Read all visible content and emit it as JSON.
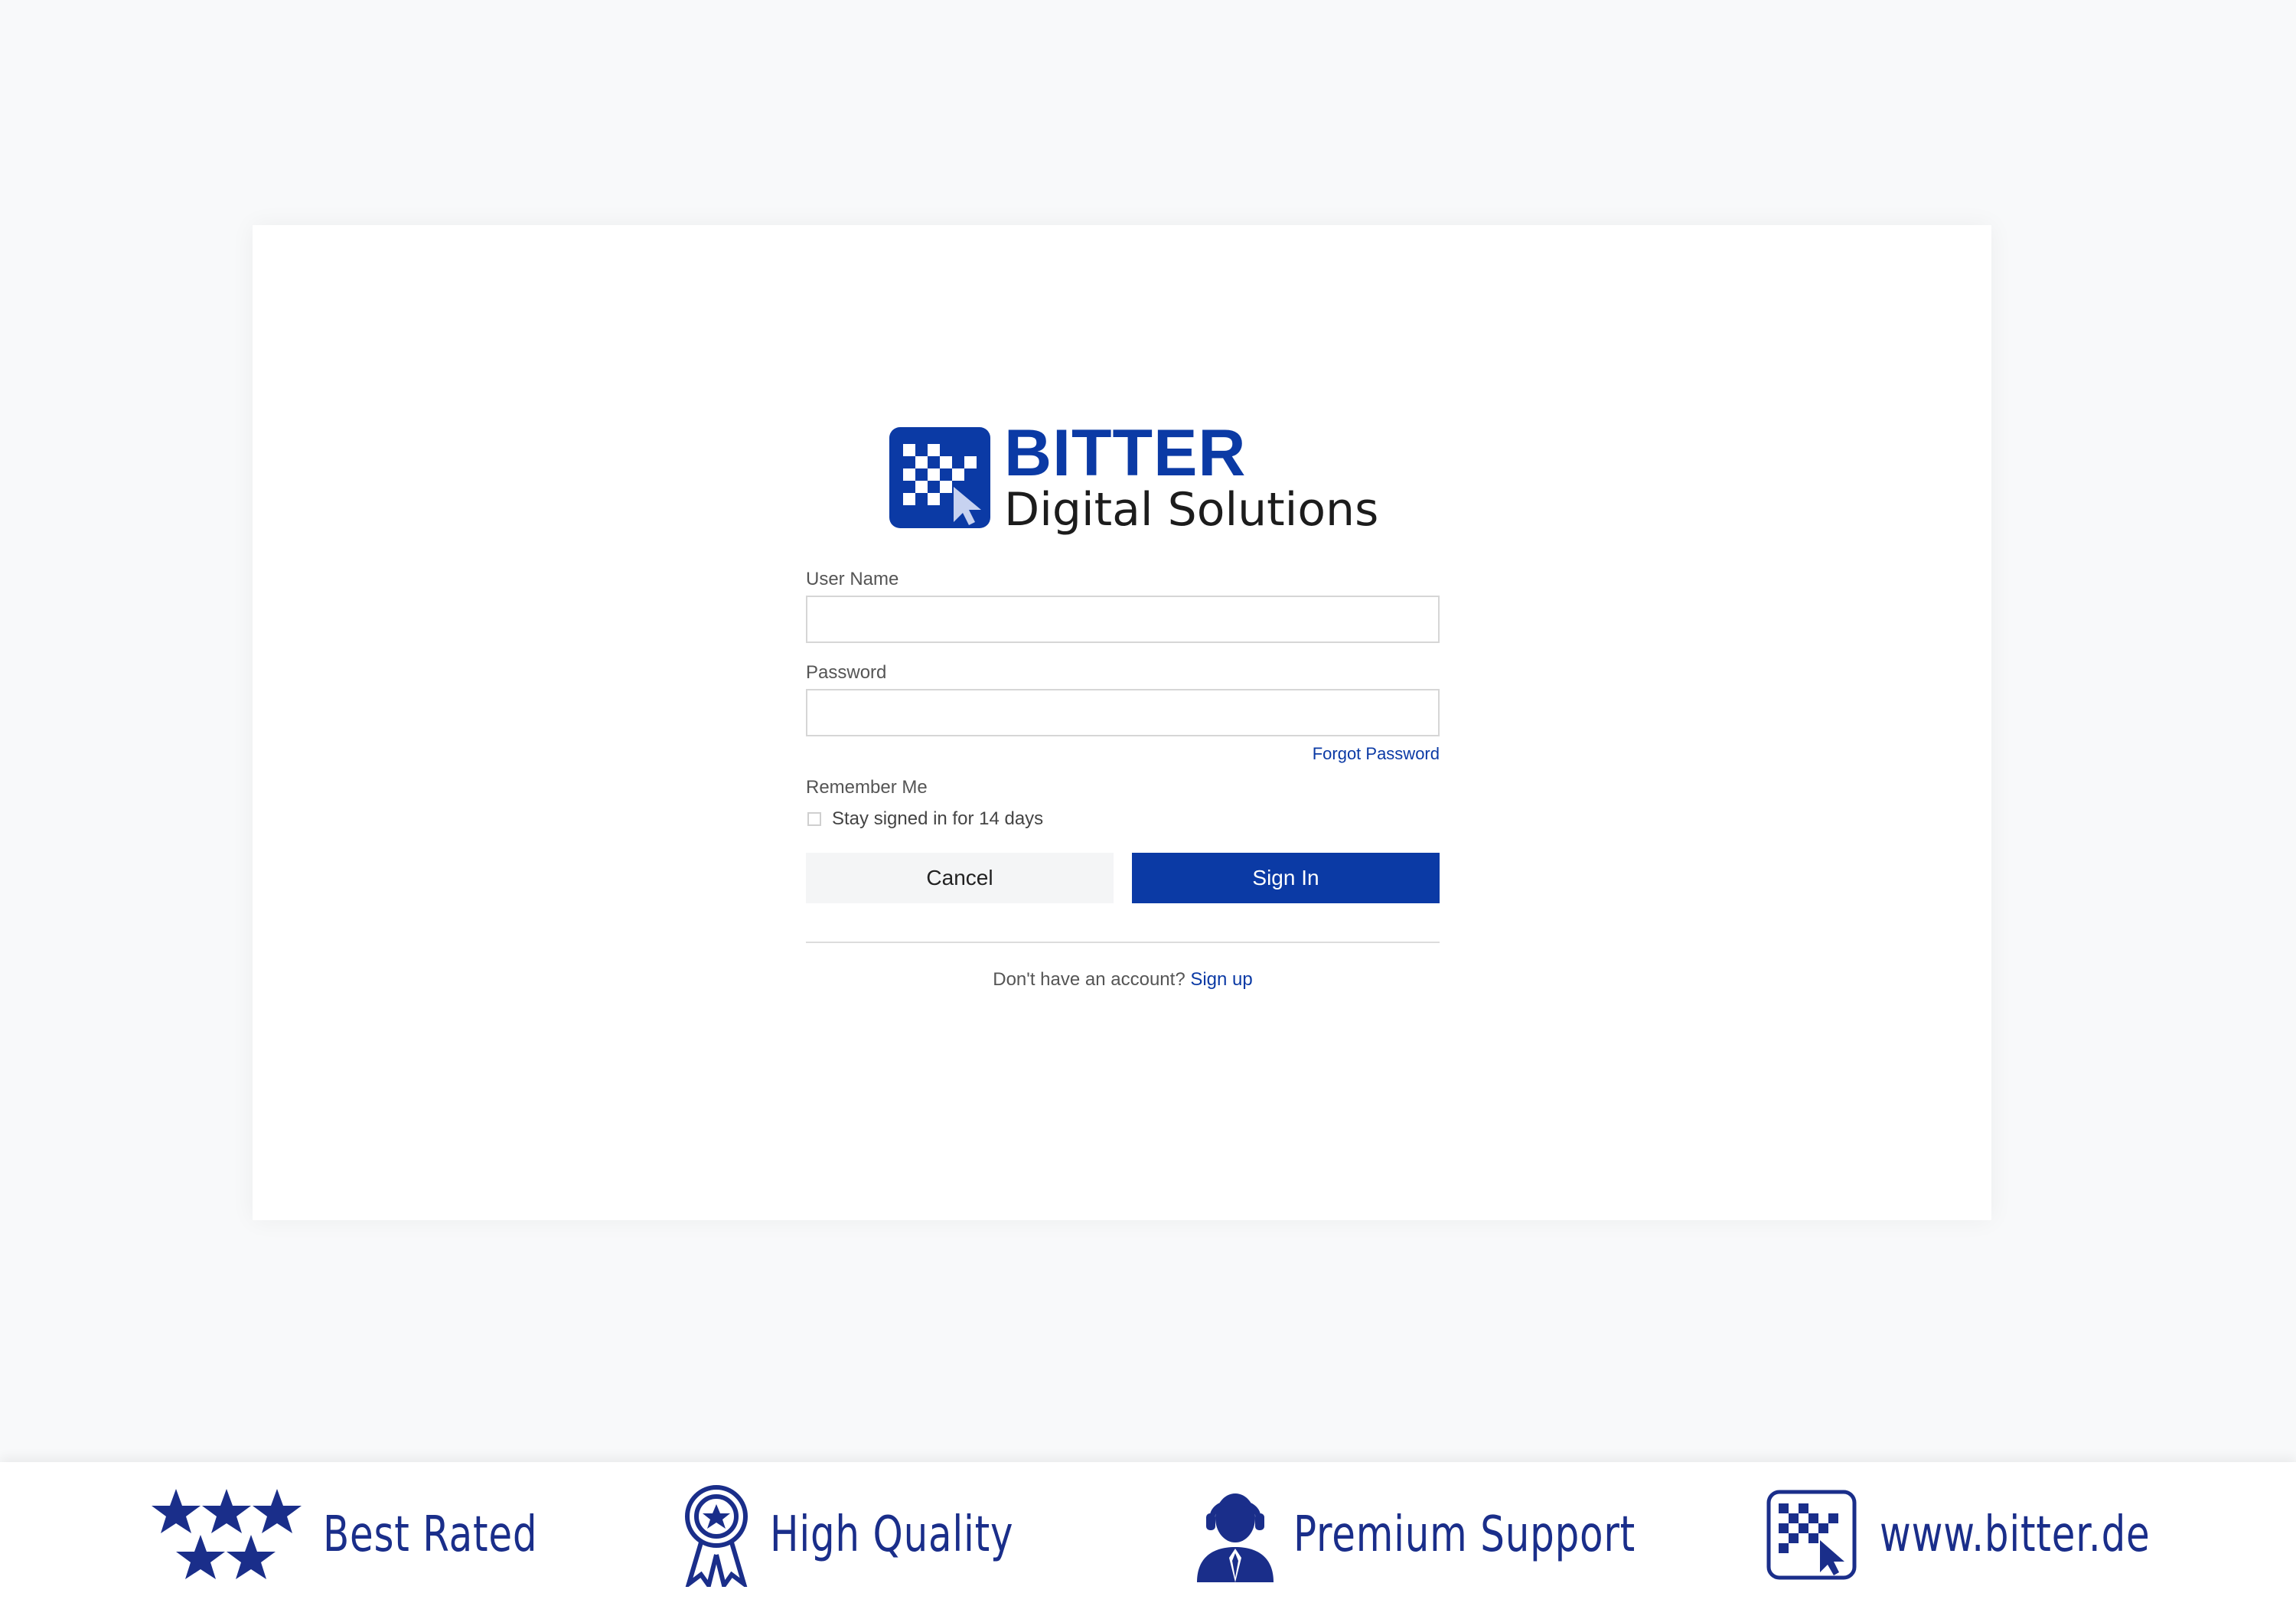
{
  "brand": {
    "title": "BITTER",
    "subtitle": "Digital Solutions",
    "color": "#0b3aa5"
  },
  "form": {
    "username_label": "User Name",
    "username_value": "",
    "password_label": "Password",
    "password_value": "",
    "forgot_password": "Forgot Password",
    "remember_label": "Remember Me",
    "remember_checkbox_text": "Stay signed in for 14 days",
    "remember_checked": false,
    "cancel_button": "Cancel",
    "signin_button": "Sign In",
    "no_account_text": "Don't have an account?",
    "signup_link": "Sign up"
  },
  "footer": {
    "badges": [
      {
        "icon": "stars-icon",
        "label": "Best Rated"
      },
      {
        "icon": "award-ribbon-icon",
        "label": "High Quality"
      },
      {
        "icon": "support-agent-icon",
        "label": "Premium Support"
      },
      {
        "icon": "bitter-logo-icon",
        "label": "www.bitter.de"
      }
    ],
    "color": "#1a2e8a"
  }
}
